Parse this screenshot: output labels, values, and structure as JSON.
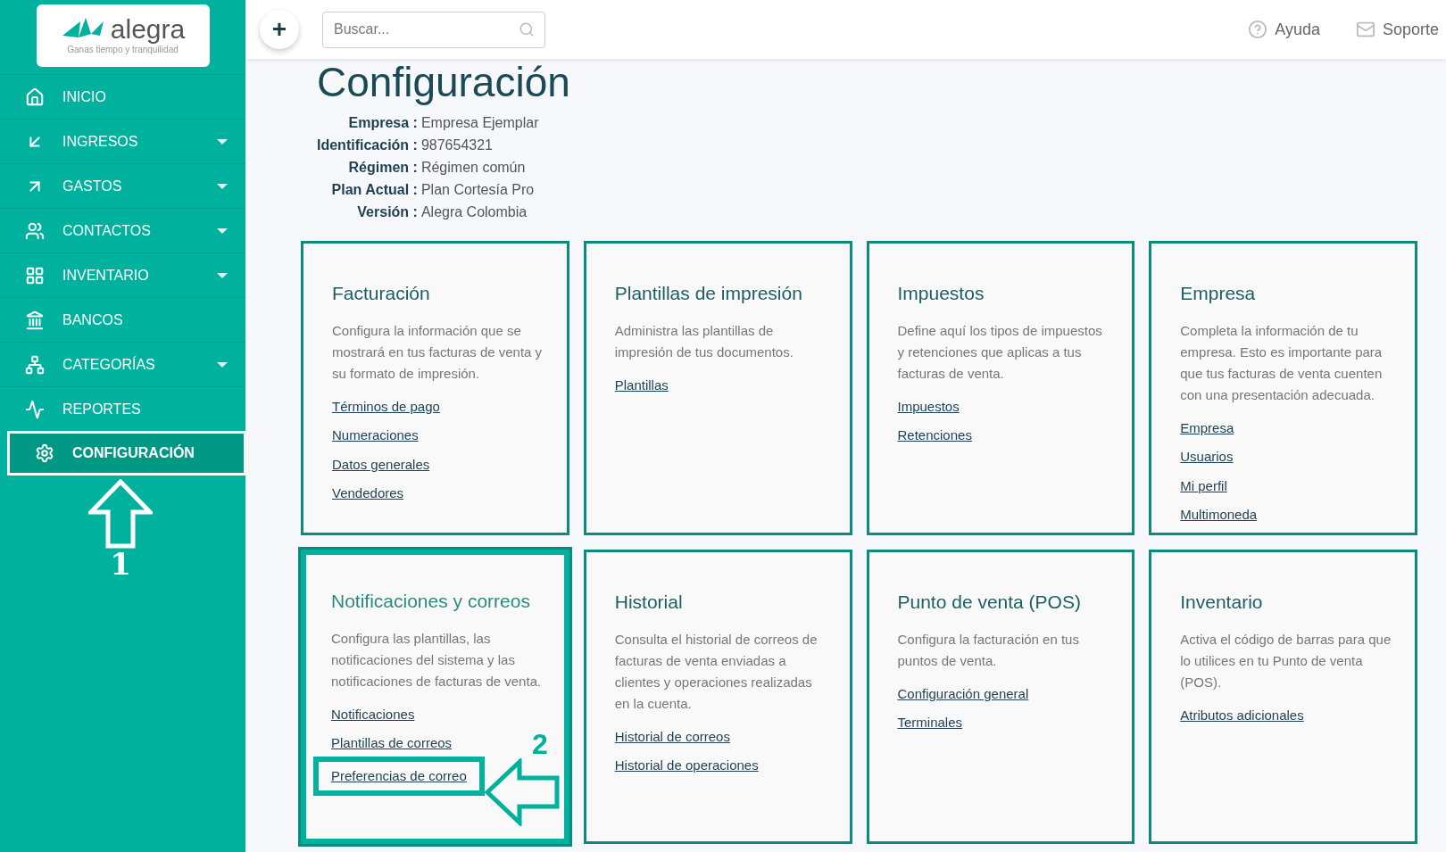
{
  "logo": {
    "name": "alegra",
    "tagline": "Ganas tiempo y tranquilidad"
  },
  "sidebar": {
    "items": [
      {
        "label": "INICIO",
        "selected": false,
        "expandable": false
      },
      {
        "label": "INGRESOS",
        "selected": false,
        "expandable": true
      },
      {
        "label": "GASTOS",
        "selected": false,
        "expandable": true
      },
      {
        "label": "CONTACTOS",
        "selected": false,
        "expandable": true
      },
      {
        "label": "INVENTARIO",
        "selected": false,
        "expandable": true
      },
      {
        "label": "BANCOS",
        "selected": false,
        "expandable": false
      },
      {
        "label": "CATEGORÍAS",
        "selected": false,
        "expandable": true
      },
      {
        "label": "REPORTES",
        "selected": false,
        "expandable": false
      },
      {
        "label": "CONFIGURACIÓN",
        "selected": true,
        "expandable": false
      }
    ]
  },
  "header": {
    "add_button": "+",
    "search": {
      "placeholder": "Buscar..."
    },
    "links": [
      "Ayuda",
      "Soporte"
    ]
  },
  "page": {
    "title": "Configuración",
    "details": [
      {
        "label": "Empresa :",
        "value": "Empresa Ejemplar"
      },
      {
        "label": "Identificación :",
        "value": "987654321"
      },
      {
        "label": "Régimen :",
        "value": "Régimen común"
      },
      {
        "label": "Plan Actual :",
        "value": "Plan Cortesía Pro"
      },
      {
        "label": "Versión :",
        "value": "Alegra Colombia"
      }
    ]
  },
  "cards": [
    {
      "title": "Facturación",
      "description": "Configura la información que se mostrará en tus facturas de venta y su formato de impresión.",
      "highlighted": false,
      "links": [
        {
          "label": "Términos de pago",
          "highlighted": false
        },
        {
          "label": "Numeraciones",
          "highlighted": false
        },
        {
          "label": "Datos generales",
          "highlighted": false
        },
        {
          "label": "Vendedores",
          "highlighted": false
        }
      ]
    },
    {
      "title": "Plantillas de impresión",
      "description": "Administra las plantillas de impresión de tus documentos.",
      "highlighted": false,
      "links": [
        {
          "label": "Plantillas",
          "highlighted": false
        }
      ]
    },
    {
      "title": "Impuestos",
      "description": "Define aquí los tipos de impuestos y retenciones que aplicas a tus facturas de venta.",
      "highlighted": false,
      "links": [
        {
          "label": "Impuestos",
          "highlighted": false
        },
        {
          "label": "Retenciones",
          "highlighted": false
        }
      ]
    },
    {
      "title": "Empresa",
      "description": "Completa la información de tu empresa. Esto es importante para que tus facturas de venta cuenten con una presentación adecuada.",
      "highlighted": false,
      "links": [
        {
          "label": "Empresa",
          "highlighted": false
        },
        {
          "label": "Usuarios",
          "highlighted": false
        },
        {
          "label": "Mi perfil",
          "highlighted": false
        },
        {
          "label": "Multimoneda",
          "highlighted": false
        }
      ]
    },
    {
      "title": "Notificaciones y correos",
      "description": "Configura las plantillas, las notificaciones del sistema y las notificaciones de facturas de venta.",
      "highlighted": true,
      "links": [
        {
          "label": "Notificaciones",
          "highlighted": false
        },
        {
          "label": "Plantillas de correos",
          "highlighted": false
        },
        {
          "label": "Preferencias de correo",
          "highlighted": true
        }
      ]
    },
    {
      "title": "Historial",
      "description": "Consulta el historial de correos de facturas de venta enviadas a clientes y operaciones realizadas en la cuenta.",
      "highlighted": false,
      "links": [
        {
          "label": "Historial de correos",
          "highlighted": false
        },
        {
          "label": "Historial de operaciones",
          "highlighted": false
        }
      ]
    },
    {
      "title": "Punto de venta (POS)",
      "description": "Configura la facturación en tus puntos de venta.",
      "highlighted": false,
      "links": [
        {
          "label": "Configuración general",
          "highlighted": false
        },
        {
          "label": "Terminales",
          "highlighted": false
        }
      ]
    },
    {
      "title": "Inventario",
      "description": "Activa el código de barras para que lo utilices en tu Punto de venta (POS).",
      "highlighted": false,
      "links": [
        {
          "label": "Atributos adicionales",
          "highlighted": false
        }
      ]
    }
  ],
  "annotations": [
    "1",
    "2"
  ]
}
